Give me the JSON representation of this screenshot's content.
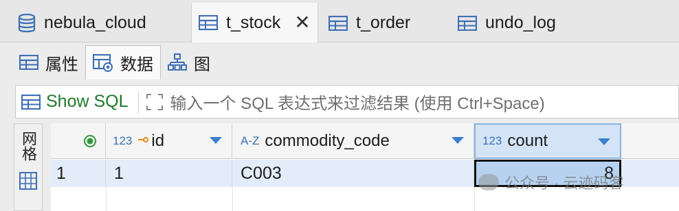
{
  "tabs": [
    {
      "label": "nebula_cloud",
      "icon": "database-icon",
      "active": false
    },
    {
      "label": "t_stock",
      "icon": "table-icon",
      "active": true
    },
    {
      "label": "t_order",
      "icon": "table-icon",
      "active": false
    },
    {
      "label": "undo_log",
      "icon": "table-icon",
      "active": false
    }
  ],
  "subtabs": [
    {
      "label": "属性",
      "icon": "table-icon"
    },
    {
      "label": "数据",
      "icon": "data-grid-icon"
    },
    {
      "label": "图",
      "icon": "diagram-icon"
    }
  ],
  "filter": {
    "show_sql_label": "Show SQL",
    "placeholder": "输入一个 SQL 表达式来过滤结果 (使用 Ctrl+Space)"
  },
  "side_panel": {
    "label": "网格"
  },
  "grid": {
    "columns": [
      {
        "type": "123",
        "name": "id",
        "key": true
      },
      {
        "type": "A-Z",
        "name": "commodity_code",
        "key": false
      },
      {
        "type": "123",
        "name": "count",
        "key": false
      }
    ],
    "rows": [
      {
        "row_number": "1",
        "cells": [
          "1",
          "C003",
          "8"
        ]
      }
    ]
  },
  "watermark": {
    "text": "公众号 · 云迹码客"
  },
  "colors": {
    "accent": "#3a7fd0",
    "show_sql_green": "#1d7a2a",
    "row_selected": "#e3edf9"
  }
}
